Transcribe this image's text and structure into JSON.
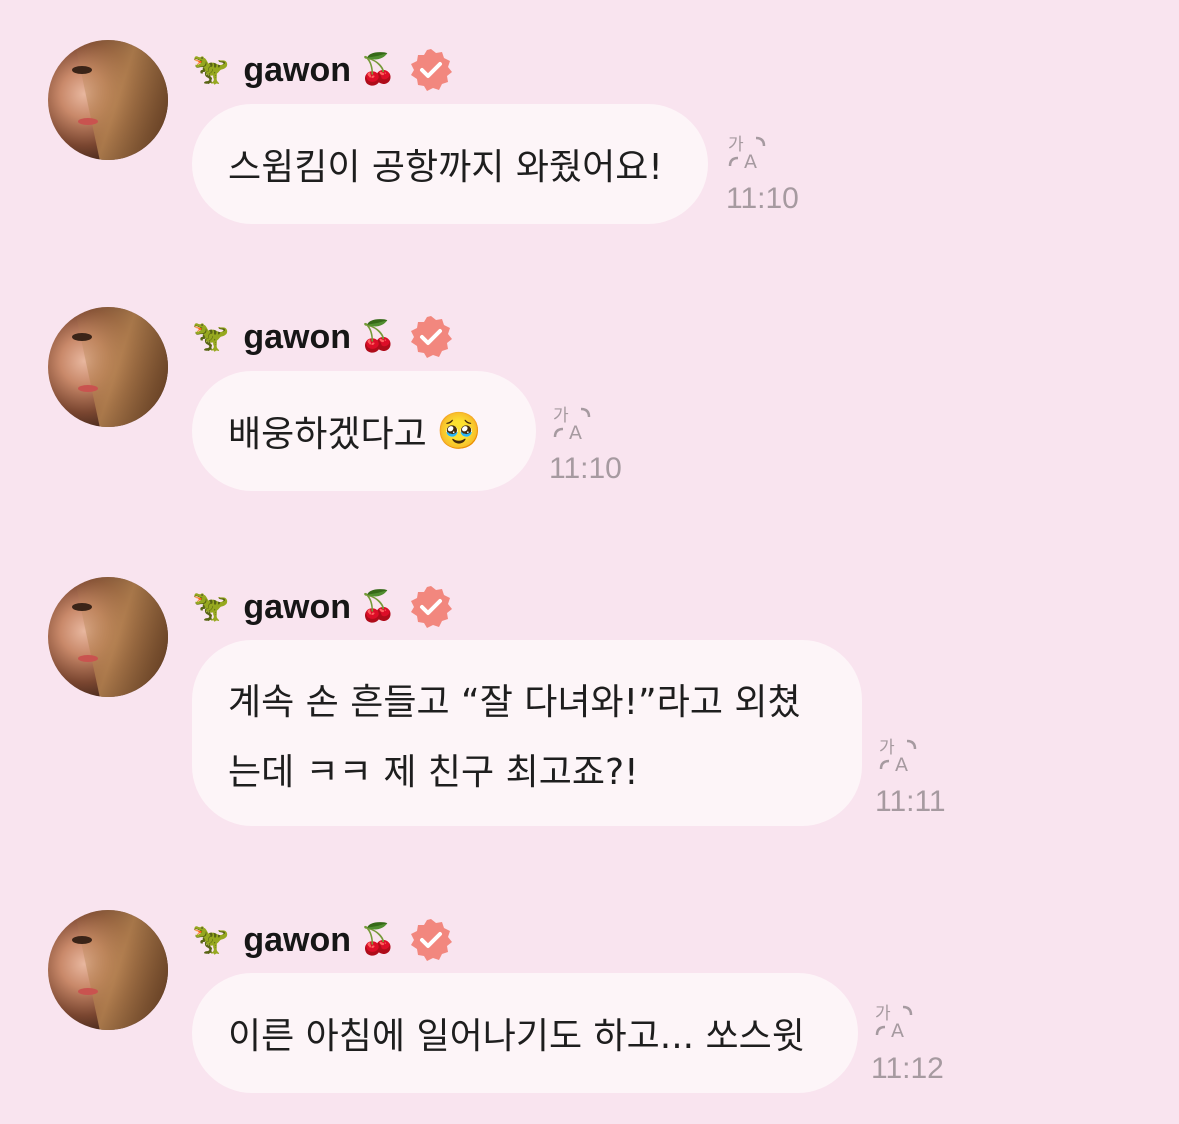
{
  "messages": [
    {
      "sender": "gawon",
      "lines": [
        "스윔킴이 공항까지 와줬어요!"
      ],
      "time": "11:10"
    },
    {
      "sender": "gawon",
      "lines": [
        "배웅하겠다고"
      ],
      "emoji": "🥹",
      "time": "11:10"
    },
    {
      "sender": "gawon",
      "lines": [
        "계속 손 흔들고 “잘 다녀와!”라고 외쳤",
        "는데 ㅋㅋ 제 친구 최고죠?!"
      ],
      "time": "11:11"
    },
    {
      "sender": "gawon",
      "lines": [
        "이른 아침에 일어나기도 하고... 쏘스윗"
      ],
      "time": "11:12"
    }
  ],
  "sender_emoji": {
    "prefix": "🦖",
    "suffix": "🍒"
  },
  "colors": {
    "background": "#f9e4ef",
    "bubble": "#fdf5f8",
    "badge": "#f2877e",
    "timestamp": "#a69aa0"
  },
  "icons": {
    "verified": "verified-badge-icon",
    "translate": "translate-icon"
  }
}
